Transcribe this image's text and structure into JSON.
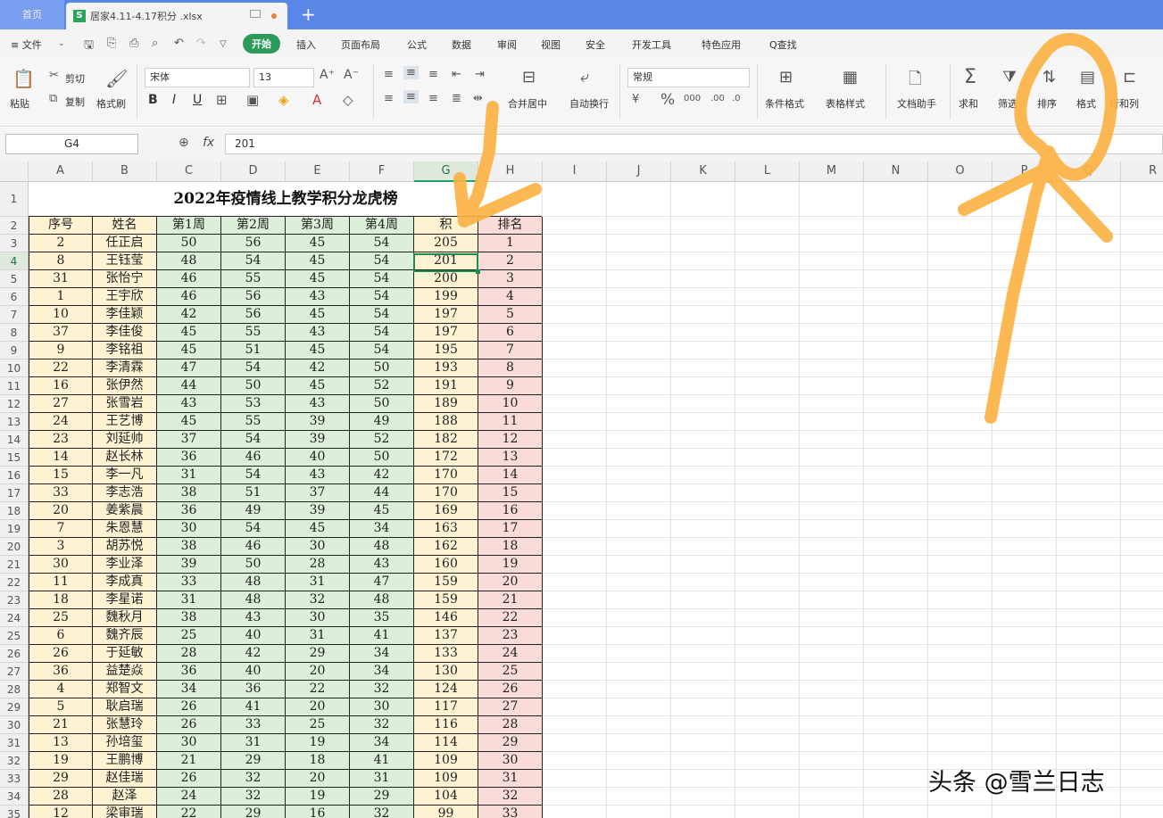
{
  "titlebar": {
    "home_tab": "首页",
    "file_tab": "居家4.11-4.17积分 .xlsx",
    "new_tab": "+"
  },
  "menu": {
    "file": "≡ 文件",
    "items": [
      "开始",
      "插入",
      "页面布局",
      "公式",
      "数据",
      "审阅",
      "视图",
      "安全",
      "开发工具",
      "特色应用"
    ],
    "search": "Q查找"
  },
  "ribbon": {
    "paste": "粘贴",
    "cut": "剪切",
    "copy": "复制",
    "format_painter": "格式刷",
    "font_name": "宋体",
    "font_size": "13",
    "merge_center": "合并居中",
    "wrap": "自动换行",
    "number_format": "常规",
    "conditional": "条件格式",
    "table_style": "表格样式",
    "doc_helper": "文档助手",
    "sum": "求和",
    "filter": "筛选",
    "sort": "排序",
    "format": "格式",
    "rowcol": "行和列"
  },
  "formula": {
    "cell_ref": "G4",
    "fx": "fx",
    "value": "201"
  },
  "grid": {
    "columns": [
      "A",
      "B",
      "C",
      "D",
      "E",
      "F",
      "G",
      "H",
      "I",
      "J",
      "K",
      "L",
      "M",
      "N",
      "O",
      "P",
      "Q",
      "R"
    ],
    "row_numbers": [
      "1",
      "2",
      "3",
      "4",
      "5",
      "6",
      "7",
      "8",
      "9",
      "10",
      "11",
      "12",
      "13",
      "14",
      "15",
      "16",
      "17",
      "18",
      "19",
      "20",
      "21",
      "22",
      "23",
      "24",
      "25",
      "26",
      "27",
      "28",
      "29",
      "30",
      "31",
      "32",
      "33",
      "34",
      "35"
    ],
    "title": "2022年疫情线上教学积分龙虎榜",
    "headers": [
      "序号",
      "姓名",
      "第1周",
      "第2周",
      "第3周",
      "第4周",
      "积",
      "排名"
    ],
    "rows": [
      [
        "2",
        "任正启",
        "50",
        "56",
        "45",
        "54",
        "205",
        "1"
      ],
      [
        "8",
        "王钰莹",
        "48",
        "54",
        "45",
        "54",
        "201",
        "2"
      ],
      [
        "31",
        "张怡宁",
        "46",
        "55",
        "45",
        "54",
        "200",
        "3"
      ],
      [
        "1",
        "王宇欣",
        "46",
        "56",
        "43",
        "54",
        "199",
        "4"
      ],
      [
        "10",
        "李佳颖",
        "42",
        "56",
        "45",
        "54",
        "197",
        "5"
      ],
      [
        "37",
        "李佳俊",
        "45",
        "55",
        "43",
        "54",
        "197",
        "6"
      ],
      [
        "9",
        "李铭祖",
        "45",
        "51",
        "45",
        "54",
        "195",
        "7"
      ],
      [
        "22",
        "李清霖",
        "47",
        "54",
        "42",
        "50",
        "193",
        "8"
      ],
      [
        "16",
        "张伊然",
        "44",
        "50",
        "45",
        "52",
        "191",
        "9"
      ],
      [
        "27",
        "张雪岩",
        "43",
        "53",
        "43",
        "50",
        "189",
        "10"
      ],
      [
        "24",
        "王艺博",
        "45",
        "55",
        "39",
        "49",
        "188",
        "11"
      ],
      [
        "23",
        "刘延帅",
        "37",
        "54",
        "39",
        "52",
        "182",
        "12"
      ],
      [
        "14",
        "赵长林",
        "36",
        "46",
        "40",
        "50",
        "172",
        "13"
      ],
      [
        "15",
        "李一凡",
        "31",
        "54",
        "43",
        "42",
        "170",
        "14"
      ],
      [
        "33",
        "李志浩",
        "38",
        "51",
        "37",
        "44",
        "170",
        "15"
      ],
      [
        "20",
        "姜紫晨",
        "36",
        "49",
        "39",
        "45",
        "169",
        "16"
      ],
      [
        "7",
        "朱恩慧",
        "30",
        "54",
        "45",
        "34",
        "163",
        "17"
      ],
      [
        "3",
        "胡苏悦",
        "38",
        "46",
        "30",
        "48",
        "162",
        "18"
      ],
      [
        "30",
        "李业泽",
        "39",
        "50",
        "28",
        "43",
        "160",
        "19"
      ],
      [
        "11",
        "李成真",
        "33",
        "48",
        "31",
        "47",
        "159",
        "20"
      ],
      [
        "18",
        "李星诺",
        "31",
        "48",
        "32",
        "48",
        "159",
        "21"
      ],
      [
        "25",
        "魏秋月",
        "38",
        "43",
        "30",
        "35",
        "146",
        "22"
      ],
      [
        "6",
        "魏齐辰",
        "25",
        "40",
        "31",
        "41",
        "137",
        "23"
      ],
      [
        "26",
        "于延敏",
        "28",
        "42",
        "29",
        "34",
        "133",
        "24"
      ],
      [
        "36",
        "益楚焱",
        "36",
        "40",
        "20",
        "34",
        "130",
        "25"
      ],
      [
        "4",
        "郑智文",
        "34",
        "36",
        "22",
        "32",
        "124",
        "26"
      ],
      [
        "5",
        "耿启瑞",
        "26",
        "41",
        "20",
        "30",
        "117",
        "27"
      ],
      [
        "21",
        "张慧玲",
        "26",
        "33",
        "25",
        "32",
        "116",
        "28"
      ],
      [
        "13",
        "孙培玺",
        "30",
        "31",
        "19",
        "34",
        "114",
        "29"
      ],
      [
        "19",
        "王鹏博",
        "21",
        "29",
        "18",
        "41",
        "109",
        "30"
      ],
      [
        "29",
        "赵佳瑞",
        "26",
        "32",
        "20",
        "31",
        "109",
        "31"
      ],
      [
        "28",
        "赵泽",
        "24",
        "32",
        "19",
        "29",
        "104",
        "32"
      ],
      [
        "12",
        "梁审瑞",
        "22",
        "29",
        "16",
        "32",
        "99",
        "33"
      ]
    ]
  },
  "watermark": "头条 @雪兰日志",
  "colors": {
    "titlebar": "#5a86e8",
    "accent": "#2c9b5a",
    "col_a": "#fdf3d3",
    "col_b": "#fdf3d3",
    "weeks": "#dcefd8",
    "total": "#fdf3d3",
    "rank": "#f9dcd7",
    "annotation": "#fbb040"
  }
}
